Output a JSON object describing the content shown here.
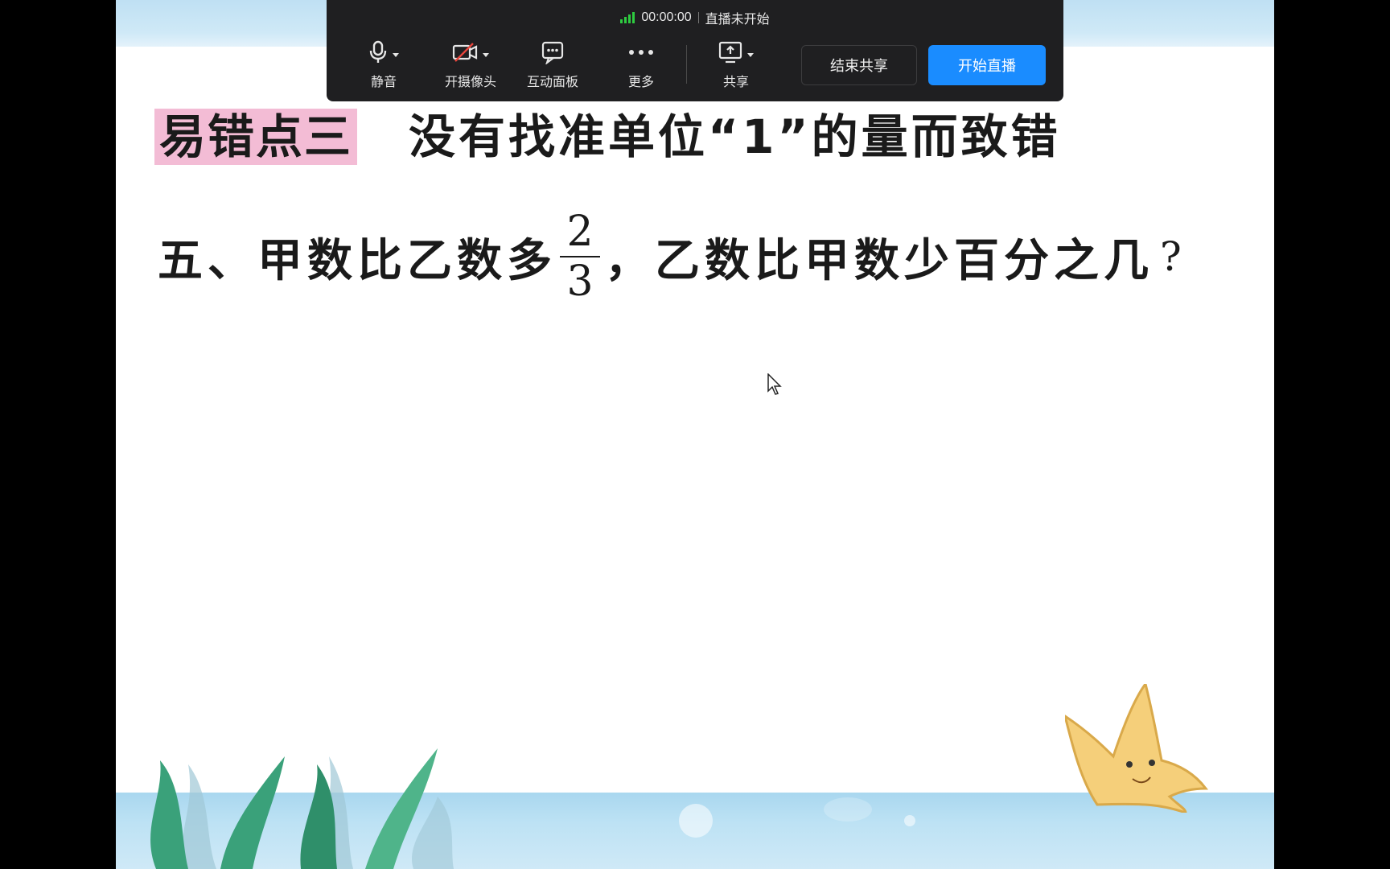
{
  "toolbar": {
    "timer": "00:00:00",
    "status": "直播未开始",
    "buttons": {
      "mute": "静音",
      "camera": "开摄像头",
      "whiteboard": "互动面板",
      "more": "更多",
      "share": "共享"
    },
    "end_share": "结束共享",
    "start_live": "开始直播",
    "icons": {
      "signal": "signal-icon",
      "mute": "microphone-icon",
      "camera": "camera-off-icon",
      "whiteboard": "chat-board-icon",
      "more": "more-dots-icon",
      "share": "screen-share-icon"
    },
    "colors": {
      "background": "#1f1f21",
      "primary_button": "#1a8cff",
      "signal": "#2ecc40"
    }
  },
  "slide": {
    "heading_tag": "易错点三",
    "heading_text": "没有找准单位“1”的量而致错",
    "question_prefix": "五、甲数比乙数多",
    "fraction_numerator": "2",
    "fraction_denominator": "3",
    "question_suffix": "，乙数比甲数少百分之几",
    "question_mark": "?",
    "colors": {
      "tag_highlight": "#f3bcd5",
      "band": "#bfe0f3"
    }
  }
}
